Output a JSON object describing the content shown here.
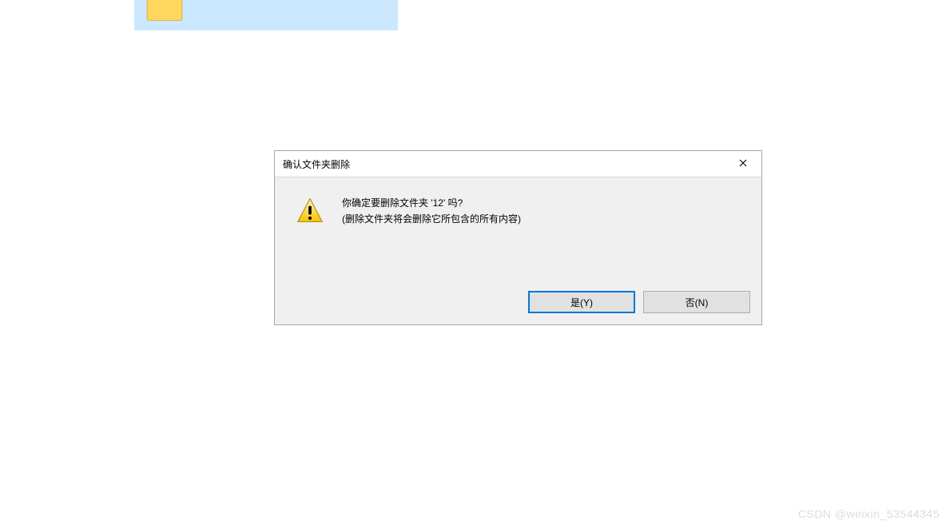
{
  "dialog": {
    "title": "确认文件夹删除",
    "message_line1": "你确定要删除文件夹 '12' 吗?",
    "message_line2": "(删除文件夹将会删除它所包含的所有内容)",
    "yes_label": "是(Y)",
    "no_label": "否(N)"
  },
  "watermark": "CSDN @weixin_53544345"
}
